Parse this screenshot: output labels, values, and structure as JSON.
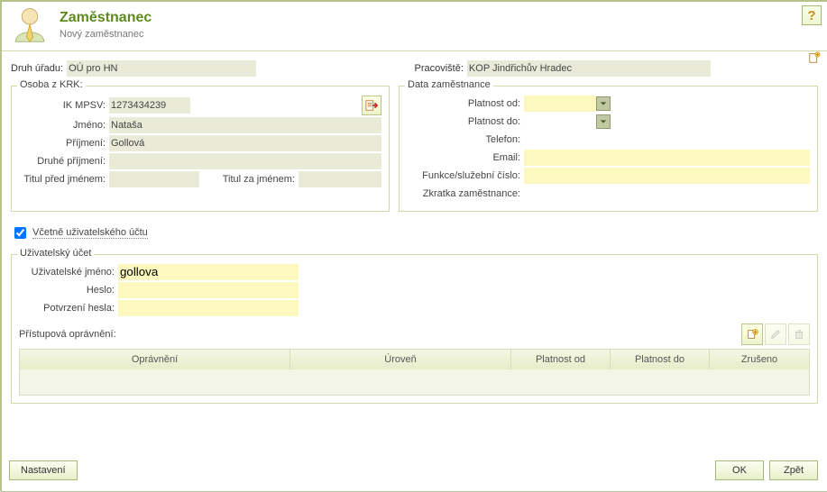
{
  "header": {
    "title": "Zaměstnanec",
    "subtitle": "Nový zaměstnanec"
  },
  "topline": {
    "druh_label": "Druh úřadu:",
    "druh_value": "OÚ pro HN",
    "prac_label": "Pracoviště:",
    "prac_value": "KOP Jindřichův Hradec"
  },
  "krk": {
    "legend": "Osoba z KRK:",
    "ik_label": "IK MPSV:",
    "ik_value": "1273434239",
    "jmeno_label": "Jméno:",
    "jmeno_value": "Nataša",
    "prijmeni_label": "Příjmení:",
    "prijmeni_value": "Gollová",
    "druhe_label": "Druhé příjmení:",
    "druhe_value": "",
    "titul_pred_label": "Titul před jménem:",
    "titul_pred_value": "",
    "titul_za_label": "Titul za jménem:",
    "titul_za_value": ""
  },
  "data_zam": {
    "legend": "Data zaměstnance",
    "plat_od_label": "Platnost od:",
    "plat_od_value": "",
    "plat_do_label": "Platnost do:",
    "plat_do_value": "",
    "tel_label": "Telefon:",
    "tel_value": "",
    "email_label": "Email:",
    "email_value": "",
    "funkce_label": "Funkce/služební číslo:",
    "funkce_value": "",
    "zkratka_label": "Zkratka zaměstnance:",
    "zkratka_value": ""
  },
  "chk": {
    "label": "Včetně uživatelského účtu",
    "checked": true
  },
  "ucet": {
    "legend": "Uživatelský účet",
    "jmeno_label": "Uživatelské jméno:",
    "jmeno_value": "gollova",
    "heslo_label": "Heslo:",
    "heslo_value": "",
    "potvrz_label": "Potvrzení hesla:",
    "potvrz_value": "",
    "perms_label": "Přístupová oprávnění:",
    "cols": {
      "opravneni": "Oprávnění",
      "uroven": "Úroveň",
      "platnost_od": "Platnost od",
      "platnost_do": "Platnost do",
      "zruseno": "Zrušeno"
    }
  },
  "buttons": {
    "nastaveni": "Nastavení",
    "ok": "OK",
    "zpet": "Zpět"
  }
}
